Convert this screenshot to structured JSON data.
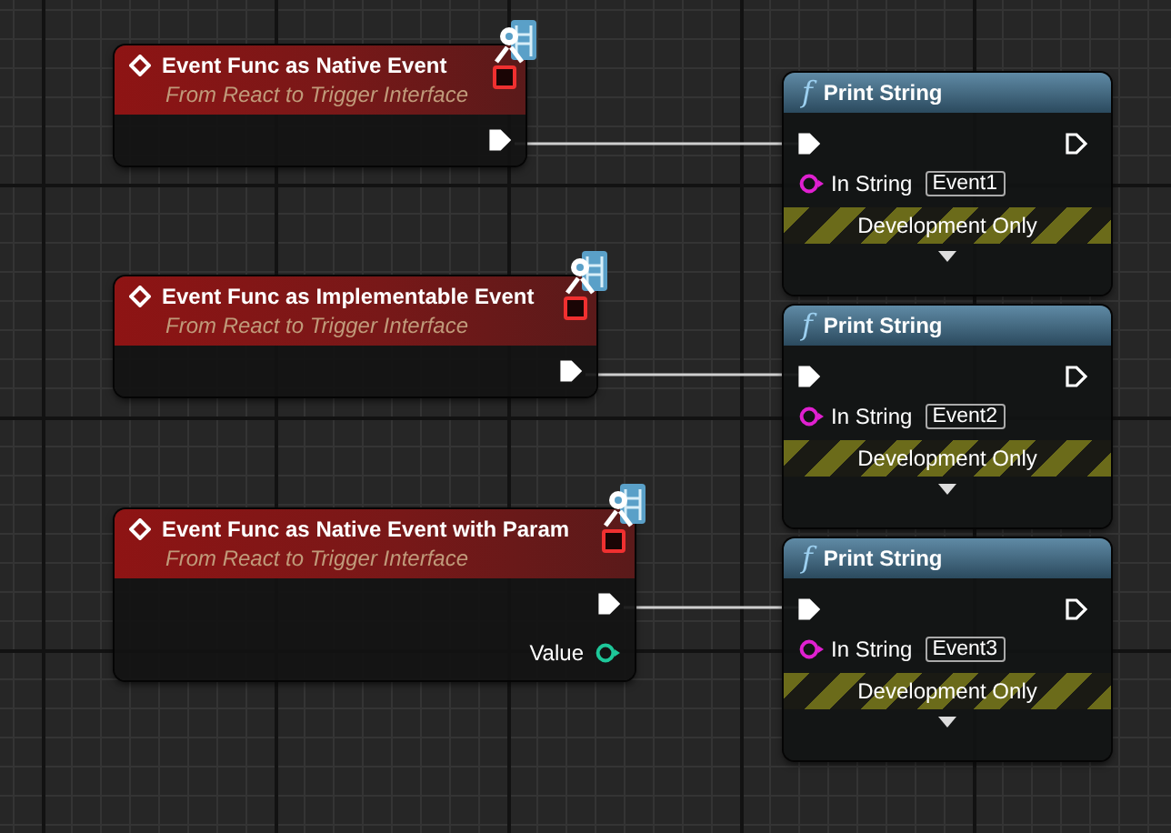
{
  "event_nodes": [
    {
      "title": "Event Func as Native Event",
      "subtitle": "From React to Trigger Interface"
    },
    {
      "title": "Event Func as Implementable Event",
      "subtitle": "From React to Trigger Interface"
    },
    {
      "title": "Event Func as Native Event with Param",
      "subtitle": "From React to Trigger Interface",
      "params": [
        {
          "label": "Value"
        }
      ]
    }
  ],
  "print_nodes": [
    {
      "icon": "f",
      "title": "Print String",
      "input_label": "In String",
      "input_value": "Event1",
      "footer": "Development Only"
    },
    {
      "icon": "f",
      "title": "Print String",
      "input_label": "In String",
      "input_value": "Event2",
      "footer": "Development Only"
    },
    {
      "icon": "f",
      "title": "Print String",
      "input_label": "In String",
      "input_value": "Event3",
      "footer": "Development Only"
    }
  ]
}
